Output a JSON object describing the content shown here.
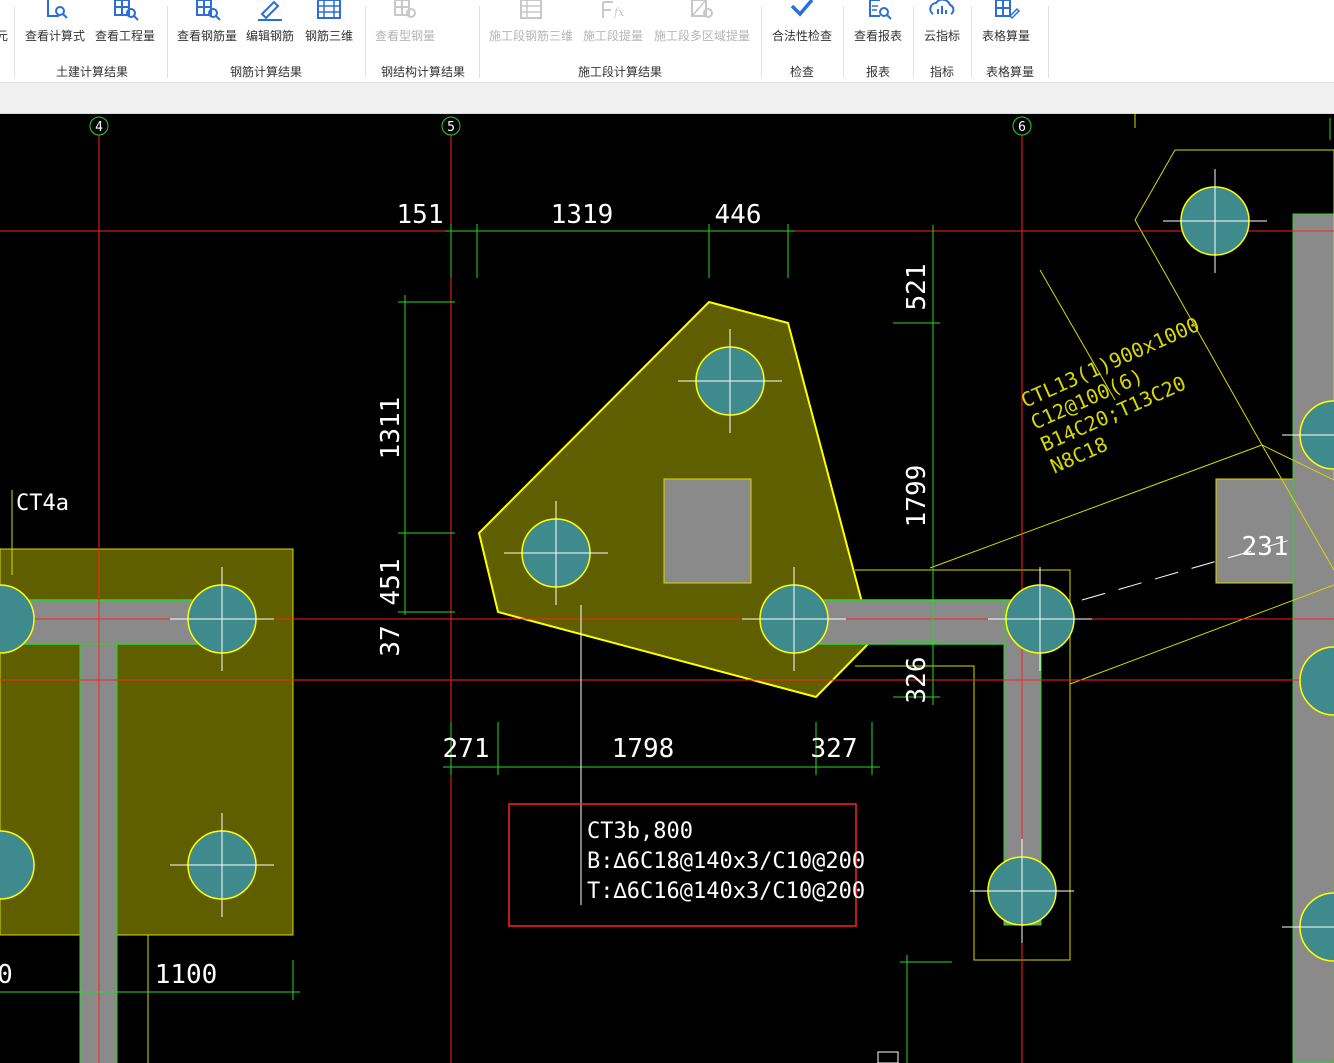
{
  "ribbon": {
    "partial_left": "元",
    "groups": [
      {
        "label": "土建计算结果",
        "buttons": [
          {
            "label": "查看计算式",
            "icon": "formula-view-icon"
          },
          {
            "label": "查看工程量",
            "icon": "quantity-view-icon"
          }
        ]
      },
      {
        "label": "钢筋计算结果",
        "buttons": [
          {
            "label": "查看钢筋量",
            "icon": "rebar-view-icon"
          },
          {
            "label": "编辑钢筋",
            "icon": "edit-rebar-icon"
          },
          {
            "label": "钢筋三维",
            "icon": "rebar-3d-icon"
          }
        ]
      },
      {
        "label": "钢结构计算结果",
        "buttons": [
          {
            "label": "查看型钢量",
            "icon": "steel-view-icon"
          }
        ]
      },
      {
        "label": "施工段计算结果",
        "buttons": [
          {
            "label": "施工段钢筋三维",
            "icon": "segment-rebar-3d-icon"
          },
          {
            "label": "施工段提量",
            "icon": "segment-fx-icon"
          },
          {
            "label": "施工段多区域提量",
            "icon": "segment-multi-area-icon"
          }
        ]
      },
      {
        "label": "检查",
        "buttons": [
          {
            "label": "合法性检查",
            "icon": "check-icon"
          }
        ]
      },
      {
        "label": "报表",
        "buttons": [
          {
            "label": "查看报表",
            "icon": "report-view-icon"
          }
        ]
      },
      {
        "label": "指标",
        "buttons": [
          {
            "label": "云指标",
            "icon": "cloud-index-icon"
          }
        ]
      },
      {
        "label": "表格算量",
        "buttons": [
          {
            "label": "表格算量",
            "icon": "table-edit-icon"
          }
        ]
      }
    ]
  },
  "cad": {
    "axes": [
      "4",
      "5",
      "6"
    ],
    "dims": {
      "d151": "151",
      "d1319": "1319",
      "d446": "446",
      "d521": "521",
      "d1311": "1311",
      "d451": "451",
      "d37": "37",
      "d1799": "1799",
      "d326": "326",
      "d271": "271",
      "d1798": "1798",
      "d327": "327",
      "d1100": "1100",
      "d0": "0",
      "d231": "231"
    },
    "labels": {
      "ct4a": "CT4a",
      "beam_lines": [
        "CTL13(1)900x1000",
        "C12@100(6)",
        "B14C20;T13C20",
        "N8C18"
      ]
    },
    "callout": {
      "lines": [
        "CT3b,800",
        "B:∆6C18@140x3/C10@200",
        "T:∆6C16@140x3/C10@200"
      ]
    }
  }
}
